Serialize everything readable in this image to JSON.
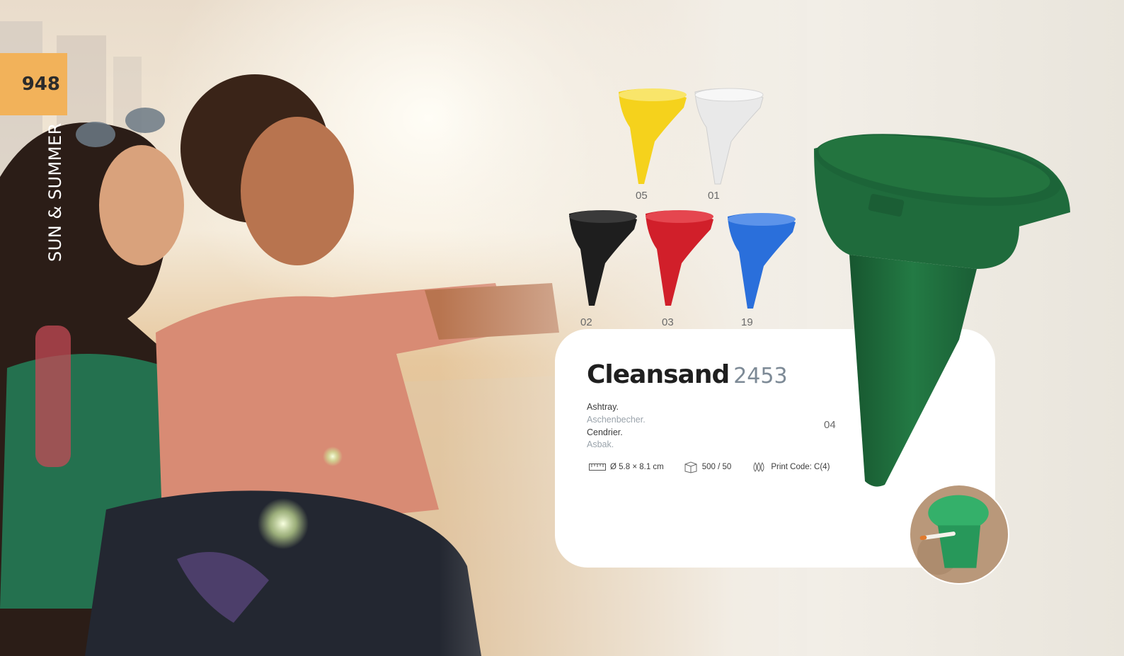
{
  "page": {
    "number": "948",
    "section": "SUN & SUMMER"
  },
  "product": {
    "name": "Cleansand",
    "ref": "2453",
    "descriptions": {
      "en": "Ashtray.",
      "de": "Aschenbecher.",
      "fr": "Cendrier.",
      "nl": "Asbak."
    },
    "specs": {
      "size": "Ø 5.8 × 8.1 cm",
      "packing": "500 / 50",
      "print": "Print Code: C(4)"
    },
    "main_color_code": "04",
    "colors": {
      "accent_tab": "#f2b25a",
      "main_green": "#1f6b3c"
    }
  },
  "variants": [
    {
      "code": "05",
      "color": "#f5d21c"
    },
    {
      "code": "01",
      "color": "#eeeeee"
    },
    {
      "code": "02",
      "color": "#1e1e1e"
    },
    {
      "code": "03",
      "color": "#d11f2a"
    },
    {
      "code": "19",
      "color": "#2a6fdb"
    }
  ],
  "icons": {
    "size": "ruler-icon",
    "packing": "box-icon",
    "print": "print-drops-icon"
  }
}
